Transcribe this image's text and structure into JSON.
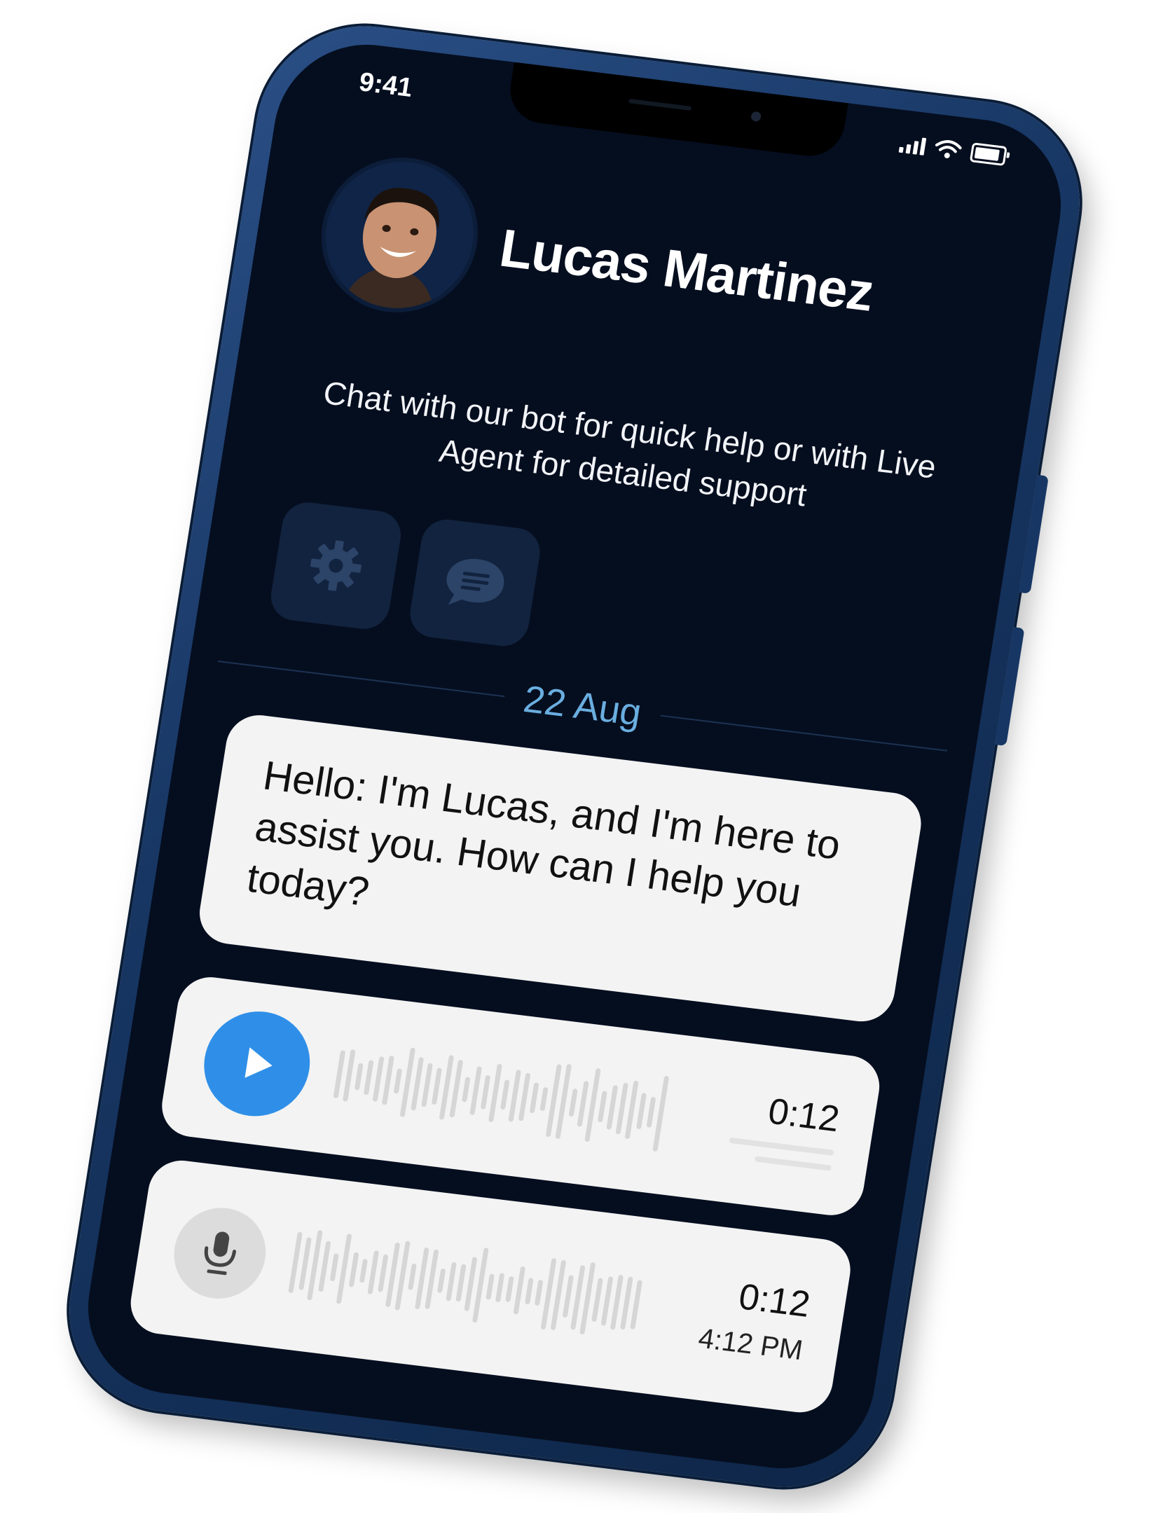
{
  "status_bar": {
    "time": "9:41",
    "icons": [
      "signal-icon",
      "wifi-icon",
      "battery-icon"
    ]
  },
  "contact": {
    "name": "Lucas Martinez",
    "avatar": "avatar-photo"
  },
  "subtitle": "Chat with our bot for quick help or with Live Agent for detailed support",
  "actions": [
    {
      "icon": "gear-icon"
    },
    {
      "icon": "chat-bubble-icon"
    }
  ],
  "date_separator": "22 Aug",
  "messages": {
    "text": "Hello: I'm Lucas, and I'm here to assist you. How can I help you today?",
    "audio_1": {
      "duration": "0:12",
      "icon": "play-icon"
    },
    "audio_2": {
      "duration": "0:12",
      "timestamp": "4:12 PM",
      "icon": "microphone-icon"
    }
  },
  "colors": {
    "screen_bg": "#050e1f",
    "frame": "#173663",
    "accent": "#2f8fe8",
    "date": "#6aaee0",
    "bubble": "#f3f3f3"
  }
}
